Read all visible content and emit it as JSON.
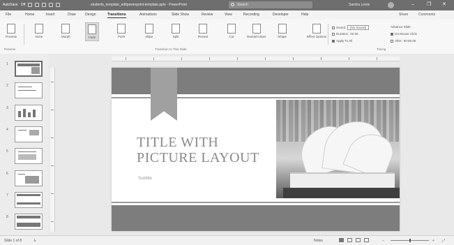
{
  "window": {
    "autosave_label": "AutoSave",
    "autosave_state": "Off",
    "title": "students_template_editpowerpoint-template.pptx - PowerPoint",
    "search_placeholder": "Search",
    "user_name": "Sandra Lewis",
    "controls": {
      "minimize": "–",
      "restore": "❐",
      "close": "✕"
    }
  },
  "tabs": [
    "File",
    "Home",
    "Insert",
    "Draw",
    "Design",
    "Transitions",
    "Animations",
    "Slide Show",
    "Review",
    "View",
    "Recording",
    "Developer",
    "Help"
  ],
  "active_tab": "Transitions",
  "tabs_right": {
    "share": "Share",
    "comments": "Comments"
  },
  "ribbon": {
    "preview_label": "Preview",
    "transitions": [
      "None",
      "Morph",
      "Fade",
      "Push",
      "Wipe",
      "Split",
      "Reveal",
      "Cut",
      "Random Bars",
      "Shape"
    ],
    "effect_options": "Effect Options",
    "groups": {
      "preview": "Preview",
      "transition_to_slide": "Transition to This Slide",
      "timing": "Timing"
    },
    "timing": {
      "sound_label": "Sound:",
      "sound_value": "[No Sound]",
      "duration_label": "Duration:",
      "duration_value": "02.00",
      "apply_all": "Apply To All",
      "advance_label": "Advance Slide",
      "on_click": "On Mouse Click",
      "after": "After:",
      "after_value": "00:00.00"
    }
  },
  "thumbnails": [
    {
      "num": "1",
      "selected": true
    },
    {
      "num": "2",
      "selected": false
    },
    {
      "num": "3",
      "selected": false
    },
    {
      "num": "4",
      "selected": false
    },
    {
      "num": "5",
      "selected": false
    },
    {
      "num": "6",
      "selected": false
    },
    {
      "num": "7",
      "selected": false
    },
    {
      "num": "8",
      "selected": false
    }
  ],
  "slide": {
    "title_line1": "TITLE WITH",
    "title_line2": "PICTURE LAYOUT",
    "subtitle": "Subtitle"
  },
  "status": {
    "slide_counter": "Slide 1 of 8",
    "notes": "Notes",
    "zoom": "+"
  },
  "colors": {
    "band": "#7d7d7d",
    "tag": "#a0a0a0",
    "title": "#8a8a8a"
  }
}
